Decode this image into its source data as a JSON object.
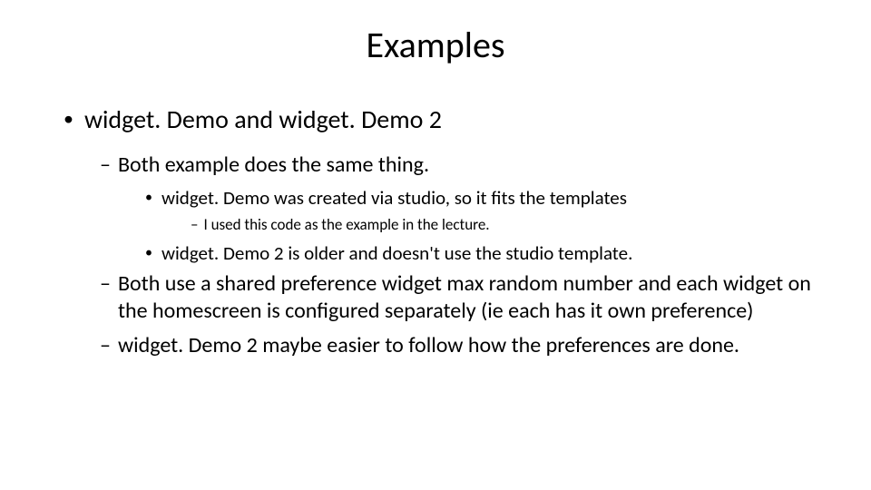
{
  "title": "Examples",
  "l1_0": "widget. Demo and widget. Demo 2",
  "l2_0": "Both example does the same thing.",
  "l3_0": "widget. Demo was created via studio, so it fits the templates",
  "l4_0": "I used this code as the example in the lecture.",
  "l3_1": "widget. Demo 2 is older and doesn't use the studio template.",
  "l2_1": "Both use a shared preference widget max random number and each widget on the homescreen is configured separately (ie each has it own preference)",
  "l2_2": "widget. Demo 2 maybe easier to follow how the preferences are done."
}
